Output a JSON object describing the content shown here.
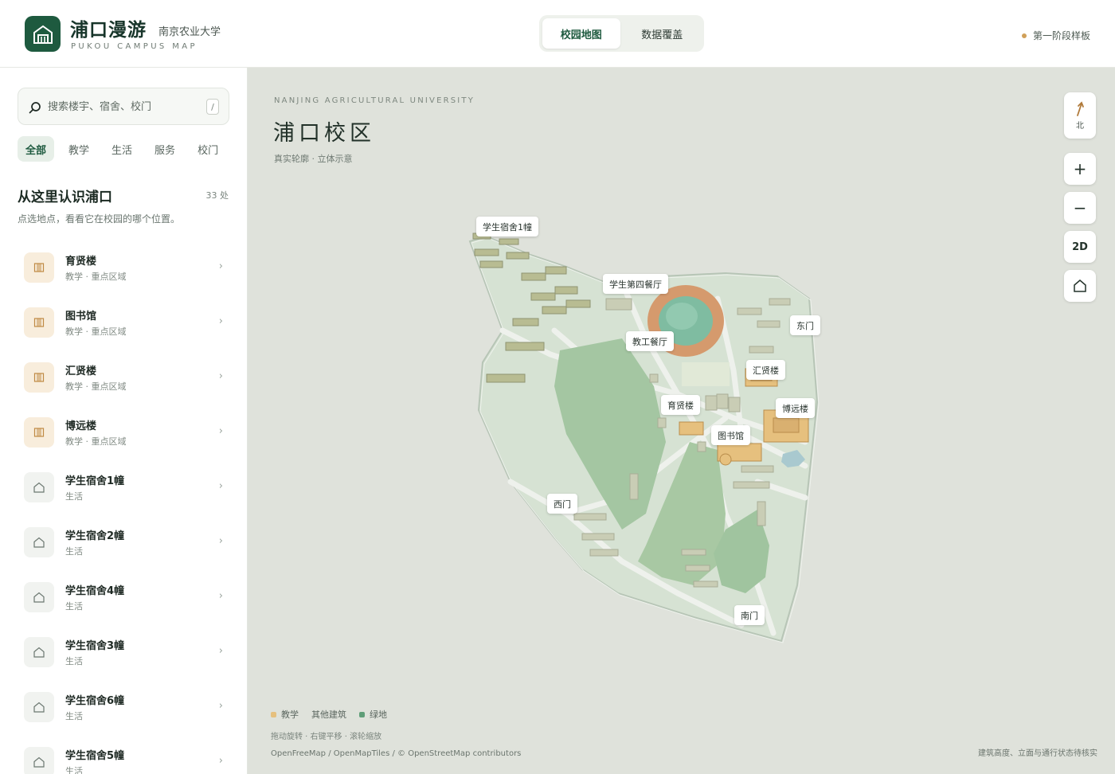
{
  "header": {
    "title": "浦口漫游",
    "university": "南京农业大学",
    "subtitle": "PUKOU CAMPUS MAP",
    "tabs": [
      {
        "label": "校园地图",
        "active": true
      },
      {
        "label": "数据覆盖",
        "active": false
      }
    ],
    "stage_label": "第一阶段样板"
  },
  "sidebar": {
    "search": {
      "placeholder": "搜索楼宇、宿舍、校门",
      "value": "",
      "shortcut": "/"
    },
    "filters": [
      {
        "label": "全部",
        "active": true
      },
      {
        "label": "教学",
        "active": false
      },
      {
        "label": "生活",
        "active": false
      },
      {
        "label": "服务",
        "active": false
      },
      {
        "label": "校门",
        "active": false
      }
    ],
    "section_title": "从这里认识浦口",
    "section_count": "33 处",
    "section_desc": "点选地点，看看它在校园的哪个位置。",
    "items": [
      {
        "name": "育贤楼",
        "meta": "教学 · 重点区域",
        "kind": "teach",
        "icon": "building-icon"
      },
      {
        "name": "图书馆",
        "meta": "教学 · 重点区域",
        "kind": "teach",
        "icon": "building-icon"
      },
      {
        "name": "汇贤楼",
        "meta": "教学 · 重点区域",
        "kind": "teach",
        "icon": "building-icon"
      },
      {
        "name": "博远楼",
        "meta": "教学 · 重点区域",
        "kind": "teach",
        "icon": "building-icon"
      },
      {
        "name": "学生宿舍1幢",
        "meta": "生活",
        "kind": "life",
        "icon": "house-icon"
      },
      {
        "name": "学生宿舍2幢",
        "meta": "生活",
        "kind": "life",
        "icon": "house-icon"
      },
      {
        "name": "学生宿舍4幢",
        "meta": "生活",
        "kind": "life",
        "icon": "house-icon"
      },
      {
        "name": "学生宿舍3幢",
        "meta": "生活",
        "kind": "life",
        "icon": "house-icon"
      },
      {
        "name": "学生宿舍6幢",
        "meta": "生活",
        "kind": "life",
        "icon": "house-icon"
      },
      {
        "name": "学生宿舍5幢",
        "meta": "生活",
        "kind": "life",
        "icon": "house-icon"
      }
    ]
  },
  "map": {
    "eyebrow": "NANJING AGRICULTURAL UNIVERSITY",
    "title": "浦口校区",
    "caption": "真实轮廓 · 立体示意",
    "labels": [
      "学生宿舍1幢",
      "学生第四餐厅",
      "东门",
      "教工餐厅",
      "汇贤楼",
      "育贤楼",
      "博远楼",
      "图书馆",
      "西门",
      "南门"
    ],
    "controls": {
      "compass": "北",
      "zoom_in": "+",
      "zoom_out": "−",
      "mode": "2D"
    },
    "legend": [
      {
        "label": "教学",
        "color": "#e6c07e"
      },
      {
        "label": "其他建筑",
        "color": ""
      },
      {
        "label": "绿地",
        "color": "#5f9e78"
      }
    ],
    "hint": "拖动旋转 · 右键平移 · 滚轮缩放",
    "attribution": "OpenFreeMap / OpenMapTiles / © OpenStreetMap contributors",
    "note": "建筑高度、立面与通行状态待核实"
  },
  "colors": {
    "brand": "#1e5a3f",
    "accent": "#d0a059",
    "map_background": "#dfe2db",
    "campus_ground": "#d8e4d6",
    "lawn": "#a3c6a1",
    "track": "#d59a6d",
    "teaching_building": "#e6c07e",
    "other_building": "#c5c9a8"
  }
}
